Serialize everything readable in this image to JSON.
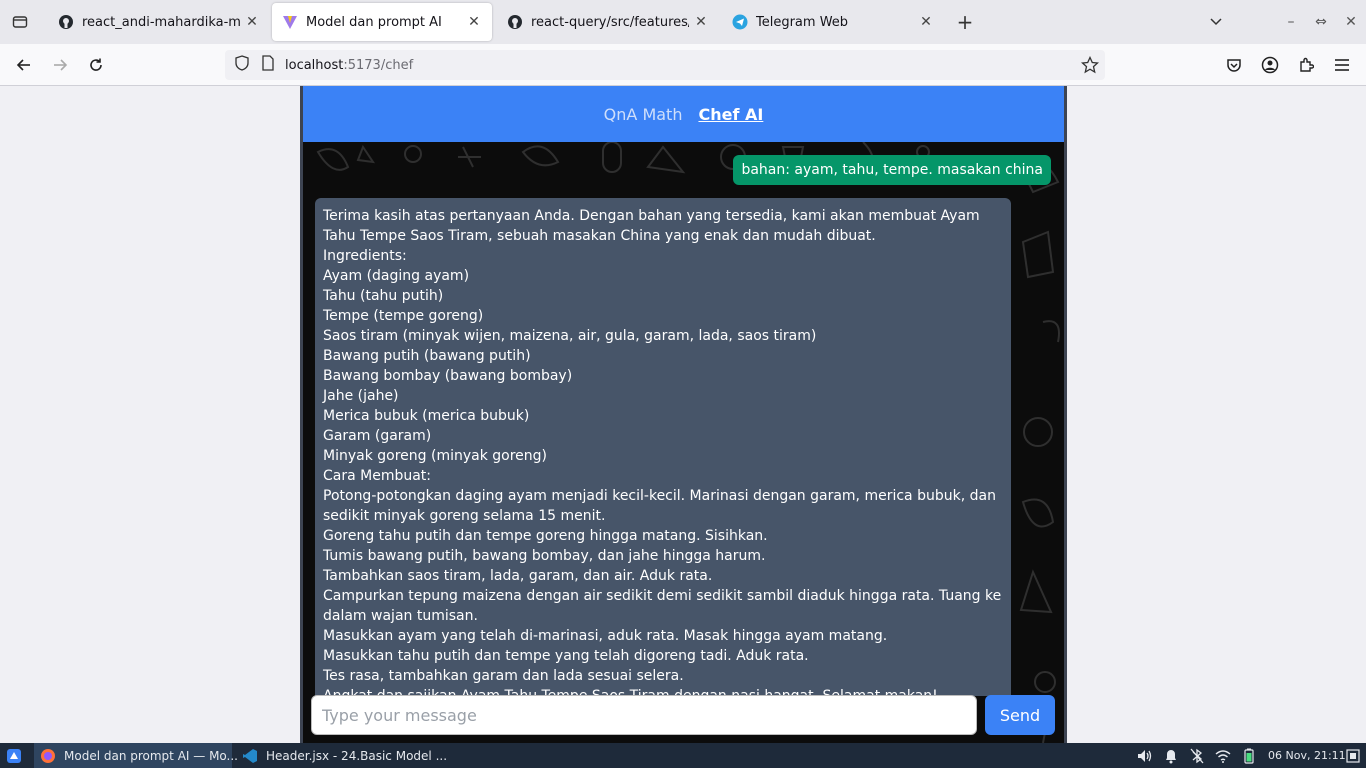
{
  "browser": {
    "tabs": [
      {
        "title": "react_andi-mahardika-mulya/"
      },
      {
        "title": "Model dan prompt AI"
      },
      {
        "title": "react-query/src/features/eve"
      },
      {
        "title": "Telegram Web"
      }
    ],
    "url_host": "localhost",
    "url_path": ":5173/chef"
  },
  "app": {
    "nav": [
      "QnA Math",
      "Chef AI"
    ],
    "user_message": "bahan: ayam, tahu, tempe. masakan china",
    "ai_lines": [
      "Terima kasih atas pertanyaan Anda. Dengan bahan yang tersedia, kami akan membuat Ayam Tahu Tempe Saos Tiram, sebuah masakan China yang enak dan mudah dibuat.",
      "Ingredients:",
      "Ayam (daging ayam)",
      "Tahu (tahu putih)",
      "Tempe (tempe goreng)",
      "Saos tiram (minyak wijen, maizena, air, gula, garam, lada, saos tiram)",
      "Bawang putih (bawang putih)",
      "Bawang bombay (bawang bombay)",
      "Jahe (jahe)",
      "Merica bubuk (merica bubuk)",
      "Garam (garam)",
      "Minyak goreng (minyak goreng)",
      "Cara Membuat:",
      "Potong-potongkan daging ayam menjadi kecil-kecil. Marinasi dengan garam, merica bubuk, dan sedikit minyak goreng selama 15 menit.",
      "Goreng tahu putih dan tempe goreng hingga matang. Sisihkan.",
      "Tumis bawang putih, bawang bombay, dan jahe hingga harum.",
      "Tambahkan saos tiram, lada, garam, dan air. Aduk rata.",
      "Campurkan tepung maizena dengan air sedikit demi sedikit sambil diaduk hingga rata. Tuang ke dalam wajan tumisan.",
      "Masukkan ayam yang telah di-marinasi, aduk rata. Masak hingga ayam matang.",
      "Masukkan tahu putih dan tempe yang telah digoreng tadi. Aduk rata.",
      "Tes rasa, tambahkan garam dan lada sesuai selera.",
      "Angkat dan sajikan Ayam Tahu Tempe Saos Tiram dengan nasi hangat. Selamat makan!"
    ],
    "input_placeholder": "Type your message",
    "send_label": "Send"
  },
  "taskbar": {
    "tasks": [
      "Model dan prompt AI — Mo...",
      "Header.jsx - 24.Basic Model ..."
    ],
    "clock": "06 Nov, 21:11"
  },
  "colors": {
    "header_blue": "#3b82f6",
    "user_bubble": "#059669",
    "ai_bubble": "#475569"
  }
}
